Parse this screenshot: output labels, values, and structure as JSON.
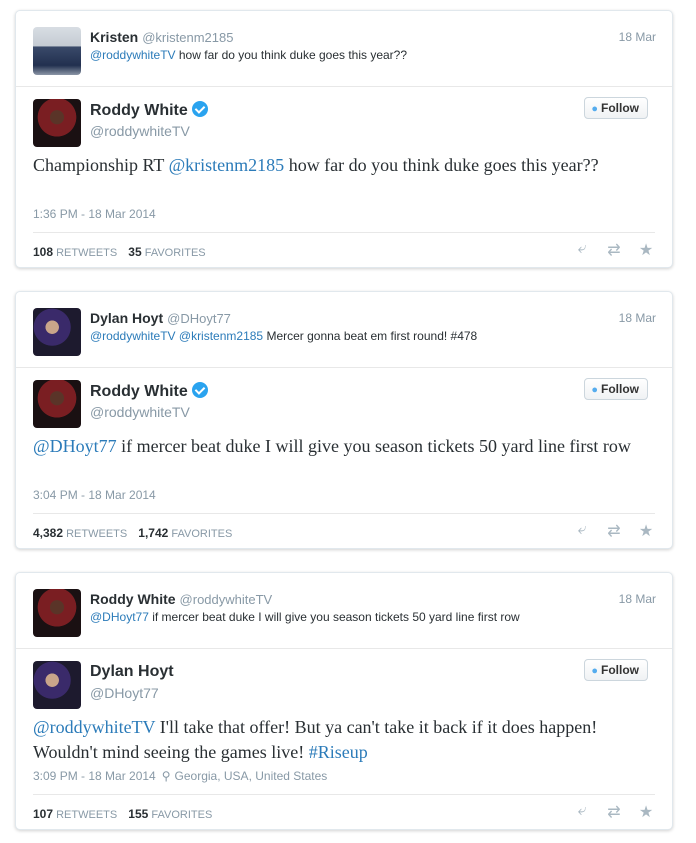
{
  "tweets": [
    {
      "reply": {
        "name": "Kristen",
        "handle": "@kristenm2185",
        "date": "18 Mar",
        "mention": "@roddywhiteTV",
        "text": " how far do you think duke goes this year??"
      },
      "main": {
        "name": "Roddy White",
        "handle": "@roddywhiteTV",
        "follow_label": "Follow",
        "body_prefix": "Championship RT ",
        "body_mention": "@kristenm2185",
        "body_rest": "  how far do you think duke goes this year??",
        "timestamp": "1:36 PM - 18 Mar 2014",
        "location": "",
        "retweets": "108",
        "retweets_label": "RETWEETS",
        "favorites": "35",
        "favorites_label": "FAVORITES"
      }
    },
    {
      "reply": {
        "name": "Dylan Hoyt",
        "handle": "@DHoyt77",
        "date": "18 Mar",
        "mention": "@roddywhiteTV @kristenm2185",
        "text": " Mercer gonna beat em first round! #478"
      },
      "main": {
        "name": "Roddy White",
        "handle": "@roddywhiteTV",
        "follow_label": "Follow",
        "body_prefix": "",
        "body_mention": "@DHoyt77",
        "body_rest": " if mercer beat duke I will give you season tickets 50 yard line first row",
        "timestamp": "3:04 PM - 18 Mar 2014",
        "location": "",
        "retweets": "4,382",
        "retweets_label": "RETWEETS",
        "favorites": "1,742",
        "favorites_label": "FAVORITES"
      }
    },
    {
      "reply": {
        "name": "Roddy White",
        "handle": "@roddywhiteTV",
        "date": "18 Mar",
        "mention": "@DHoyt77",
        "text": " if mercer beat duke I will give you season tickets 50 yard line first row"
      },
      "main": {
        "name": "Dylan Hoyt",
        "handle": "@DHoyt77",
        "follow_label": "Follow",
        "body_prefix": "",
        "body_mention": "@roddywhiteTV",
        "body_rest": " I'll take that offer! But ya can't take it back if it does happen! Wouldn't mind seeing the games live! ",
        "body_hashtag": "#Riseup",
        "timestamp": "3:09 PM - 18 Mar 2014",
        "location": "Georgia, USA, United States",
        "retweets": "107",
        "retweets_label": "RETWEETS",
        "favorites": "155",
        "favorites_label": "FAVORITES"
      }
    }
  ],
  "icons": {
    "reply": "reply-icon",
    "retweet": "retweet-icon",
    "favorite": "star-icon",
    "bird": "twitter-bird-icon",
    "pin": "location-pin-icon"
  },
  "colors": {
    "link": "#2b7bb9",
    "verified": "#2aa3ef",
    "muted": "#8899a6"
  }
}
